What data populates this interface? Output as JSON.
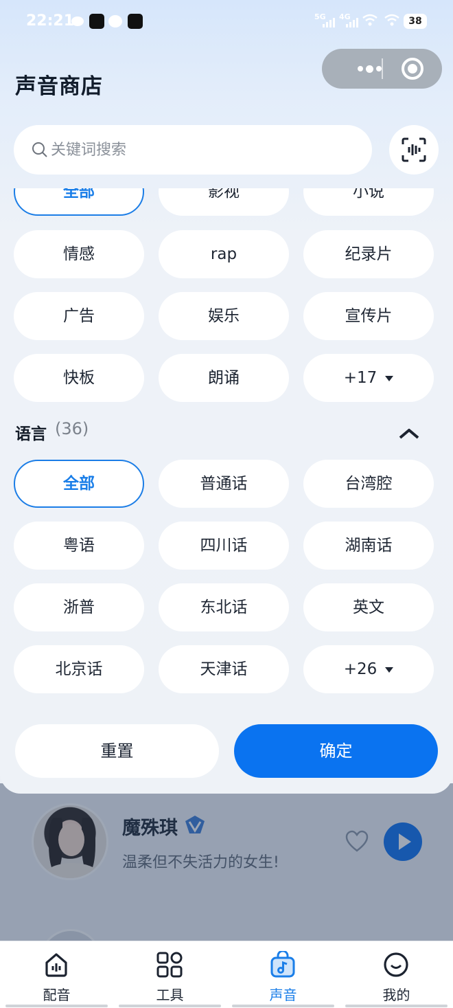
{
  "status_bar": {
    "time": "22:21",
    "battery": "38",
    "signal_5g": "5G",
    "signal_4g": "4G"
  },
  "header": {
    "title": "声音商店"
  },
  "search": {
    "placeholder": "关键词搜索"
  },
  "categories": {
    "items": [
      {
        "label": "全部",
        "active": true
      },
      {
        "label": "影视"
      },
      {
        "label": "小说"
      },
      {
        "label": "情感"
      },
      {
        "label": "rap"
      },
      {
        "label": "纪录片"
      },
      {
        "label": "广告"
      },
      {
        "label": "娱乐"
      },
      {
        "label": "宣传片"
      },
      {
        "label": "快板"
      },
      {
        "label": "朗诵"
      },
      {
        "label": "+17",
        "more": true
      }
    ]
  },
  "language": {
    "title": "语言",
    "count": "(36)",
    "items": [
      {
        "label": "全部",
        "active": true
      },
      {
        "label": "普通话"
      },
      {
        "label": "台湾腔"
      },
      {
        "label": "粤语"
      },
      {
        "label": "四川话"
      },
      {
        "label": "湖南话"
      },
      {
        "label": "浙普"
      },
      {
        "label": "东北话"
      },
      {
        "label": "英文"
      },
      {
        "label": "北京话"
      },
      {
        "label": "天津话"
      },
      {
        "label": "+26",
        "more": true
      }
    ]
  },
  "actions": {
    "reset": "重置",
    "confirm": "确定"
  },
  "voice_card": {
    "name": "魔殊琪",
    "description": "温柔但不失活力的女生!"
  },
  "tabbar": {
    "tabs": [
      {
        "label": "配音",
        "icon": "dub-icon"
      },
      {
        "label": "工具",
        "icon": "tools-icon"
      },
      {
        "label": "声音",
        "icon": "voice-bag-icon",
        "active": true
      },
      {
        "label": "我的",
        "icon": "profile-smile-icon"
      }
    ]
  },
  "colors": {
    "accent": "#0a73f0",
    "active_chip_text": "#1a7ee8"
  }
}
